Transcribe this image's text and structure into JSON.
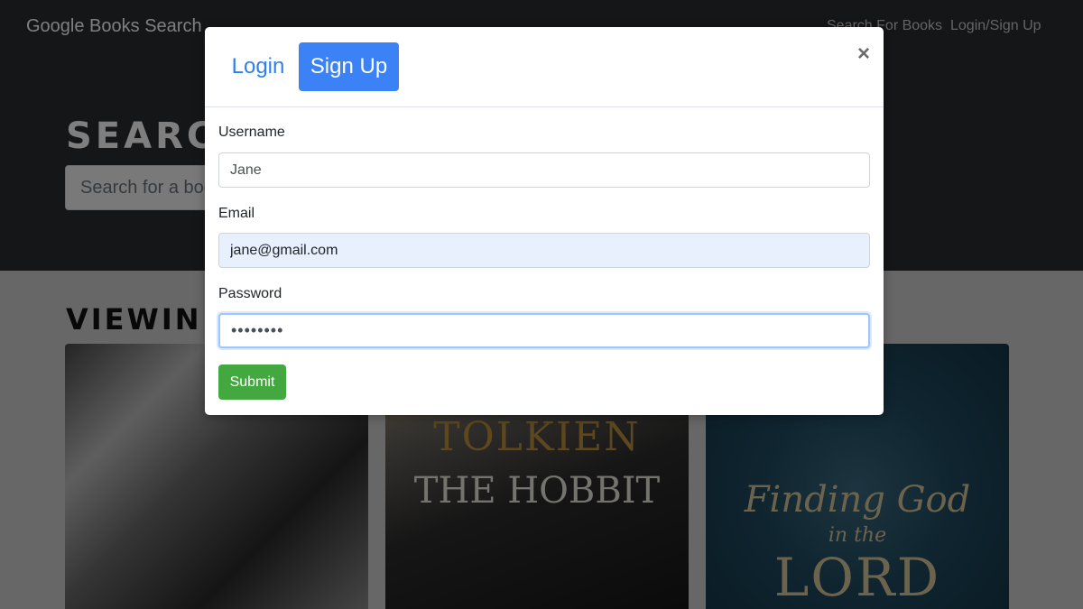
{
  "navbar": {
    "brand": "Google Books Search",
    "links": [
      "Search For Books",
      "Login/Sign Up"
    ]
  },
  "hero": {
    "title": "SEARC",
    "search_placeholder": "Search for a boo"
  },
  "results": {
    "title": "VIEWIN",
    "books": [
      {
        "text": []
      },
      {
        "text": [
          "TOLKIEN",
          "THE HOBBIT"
        ]
      },
      {
        "text": [
          "Finding God",
          "in the",
          "LORD"
        ]
      }
    ]
  },
  "modal": {
    "tabs": [
      "Login",
      "Sign Up"
    ],
    "active_tab": "Sign Up",
    "close_symbol": "×",
    "fields": [
      {
        "label": "Username",
        "value": "Jane"
      },
      {
        "label": "Email",
        "value": "jane@gmail.com"
      },
      {
        "label": "Password",
        "value": "••••••••"
      }
    ],
    "submit_label": "Submit"
  },
  "colors": {
    "navbar_bg": "#2b2c31",
    "primary": "#3b82f6",
    "submit": "#43a83f"
  }
}
